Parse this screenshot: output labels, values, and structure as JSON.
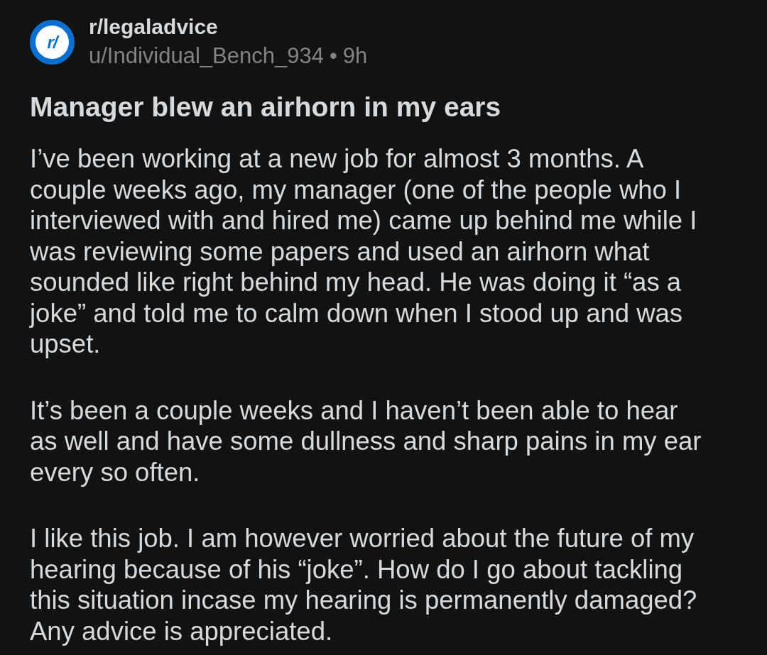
{
  "post": {
    "subreddit": "r/legaladvice",
    "avatar_text": "r/",
    "author": "u/Individual_Bench_934",
    "separator": "•",
    "age": "9h",
    "title": "Manager blew an airhorn in my ears",
    "paragraphs": [
      "I’ve been working at a new job for almost 3 months. A couple weeks ago, my manager (one of the people who I interviewed with and hired me) came up behind me while I was reviewing some papers and used an airhorn what sounded like right behind my head. He was doing it “as a joke” and told me to calm down when I stood up and was upset.",
      "It’s been a couple weeks and I haven’t been able to hear as well and have some dullness and sharp pains in my ear every so often.",
      "I like this job. I am however worried about the future of my hearing because of his “joke”. How do I go about tackling this situation incase my hearing is permanently damaged? Any advice is appreciated."
    ]
  }
}
